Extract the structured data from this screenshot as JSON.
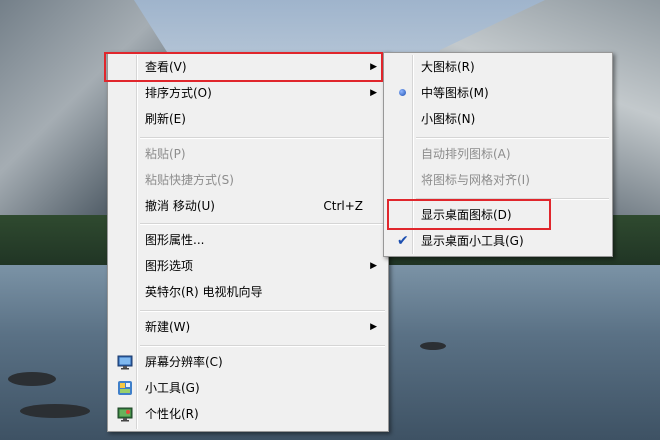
{
  "context_menu": {
    "items": [
      {
        "label": "查看(V)",
        "submenu": true
      },
      {
        "label": "排序方式(O)",
        "submenu": true
      },
      {
        "label": "刷新(E)"
      },
      {
        "label": "粘贴(P)",
        "disabled": true
      },
      {
        "label": "粘贴快捷方式(S)",
        "disabled": true
      },
      {
        "label": "撤消 移动(U)",
        "shortcut": "Ctrl+Z"
      },
      {
        "label": "图形属性..."
      },
      {
        "label": "图形选项",
        "submenu": true
      },
      {
        "label": "英特尔(R) 电视机向导"
      },
      {
        "label": "新建(W)",
        "submenu": true
      },
      {
        "label": "屏幕分辨率(C)",
        "icon": "monitor-icon"
      },
      {
        "label": "小工具(G)",
        "icon": "gadgets-icon"
      },
      {
        "label": "个性化(R)",
        "icon": "personalize-icon"
      }
    ]
  },
  "view_submenu": {
    "items": [
      {
        "label": "大图标(R)"
      },
      {
        "label": "中等图标(M)",
        "selected": true
      },
      {
        "label": "小图标(N)"
      },
      {
        "label": "自动排列图标(A)",
        "disabled": true
      },
      {
        "label": "将图标与网格对齐(I)",
        "disabled": true
      },
      {
        "label": "显示桌面图标(D)"
      },
      {
        "label": "显示桌面小工具(G)",
        "checked": true
      }
    ]
  },
  "glyphs": {
    "submenu_arrow": "▶",
    "check": "✔"
  },
  "colors": {
    "highlight_border": "#e0262c",
    "menu_bg": "#f0f0f0"
  }
}
